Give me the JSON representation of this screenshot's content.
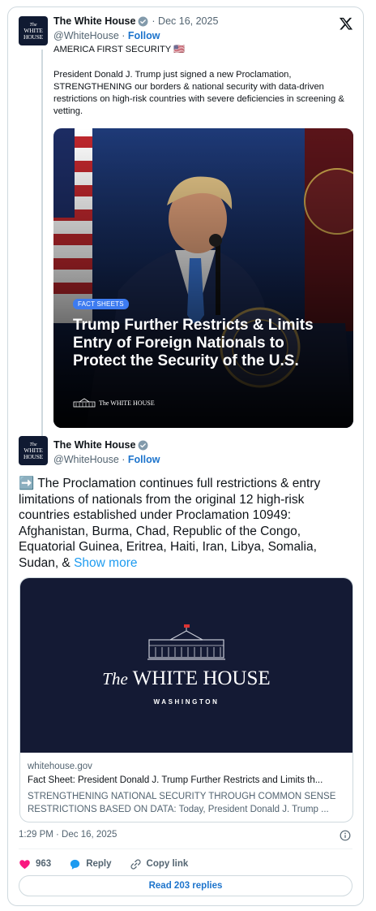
{
  "tweet1": {
    "name": "The White House",
    "date": "· Dec 16, 2025",
    "handle": "@WhiteHouse",
    "separator": " · ",
    "follow_label": "Follow",
    "line1": "AMERICA FIRST SECURITY 🇺🇸",
    "paragraph": "President Donald J. Trump just signed a new Proclamation, STRENGTHENING our borders & national security with data-driven restrictions on high-risk countries with severe deficiencies in screening & vetting.",
    "media": {
      "badge": "FACT SHEETS",
      "headline": "Trump Further Restricts & Limits Entry of Foreign Nationals to Protect the Security of the U.S.",
      "mark": "The WHITE HOUSE"
    }
  },
  "avatar": {
    "line1": "The",
    "line2": "WHITE",
    "line3": "HOUSE"
  },
  "tweet2": {
    "name": "The White House",
    "handle": "@WhiteHouse",
    "separator": " · ",
    "follow_label": "Follow",
    "text": "➡️ The Proclamation continues full restrictions & entry limitations of nationals from the original 12 high-risk countries established under Proclamation 10949: Afghanistan, Burma, Chad, Republic of the Congo, Equatorial Guinea, Eritrea, Haiti, Iran, Libya, Somalia, Sudan, & ",
    "show_more": "Show more"
  },
  "link_card": {
    "image_the": "The",
    "image_title": "WHITE HOUSE",
    "image_sub": "WASHINGTON",
    "domain": "whitehouse.gov",
    "title": "Fact Sheet: President Donald J. Trump Further Restricts and Limits th...",
    "description": "STRENGTHENING NATIONAL SECURITY THROUGH COMMON SENSE RESTRICTIONS BASED ON DATA: Today, President Donald J. Trump ..."
  },
  "footer": {
    "timestamp": "1:29 PM · Dec 16, 2025",
    "likes": "963",
    "reply_label": "Reply",
    "copy_link_label": "Copy link",
    "read_replies": "Read 203 replies"
  },
  "colors": {
    "accent": "#1d9bf0",
    "like": "#f91880",
    "navy": "#141a34"
  }
}
